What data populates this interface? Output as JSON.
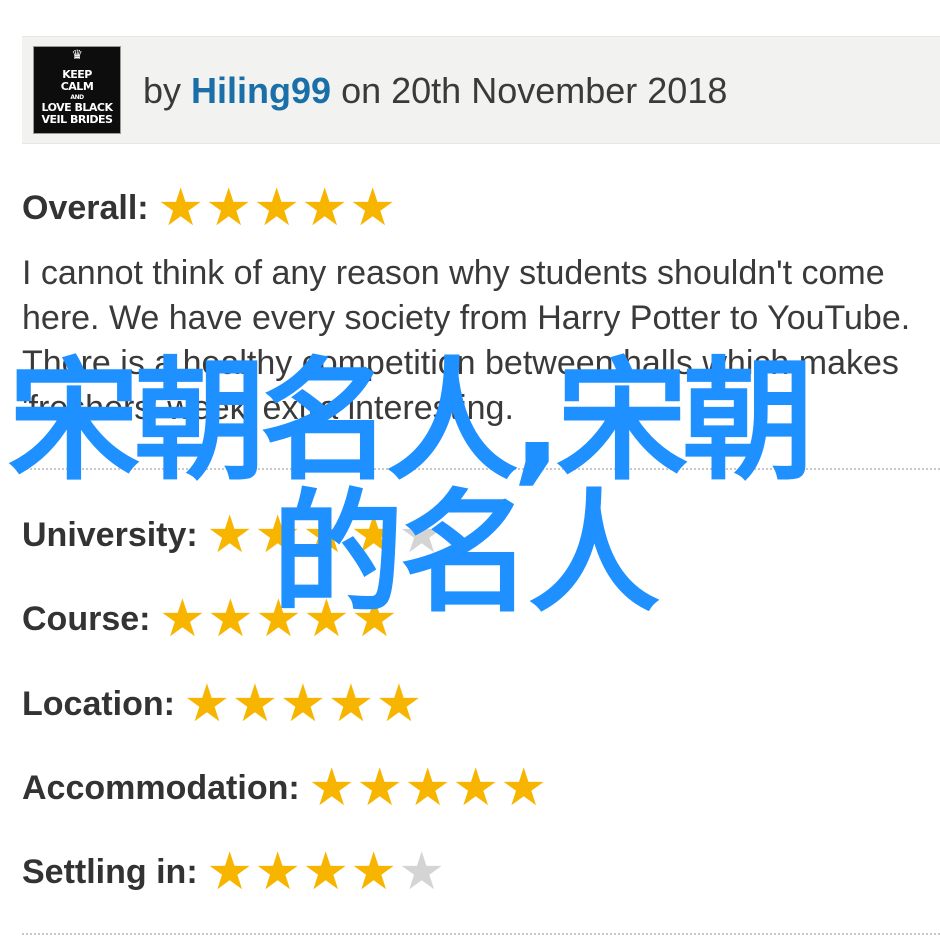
{
  "review_header": {
    "avatar_text": {
      "line1": "KEEP",
      "line2": "CALM",
      "line3": "AND",
      "line4": "LOVE BLACK",
      "line5": "VEIL BRIDES"
    },
    "by_prefix": "by",
    "username": "Hiling99",
    "date_text": "on 20th November 2018"
  },
  "overall": {
    "label": "Overall:",
    "rating": 5,
    "max": 5
  },
  "review_text": "I cannot think of any reason why students shouldn't come here. We have every society from Harry Potter to YouTube. There is a healthy competition between halls which makes 'freshers' week' extra interesting.",
  "categories": [
    {
      "label": "University:",
      "rating": 4,
      "max": 5
    },
    {
      "label": "Course:",
      "rating": 5,
      "max": 5
    },
    {
      "label": "Location:",
      "rating": 5,
      "max": 5
    },
    {
      "label": "Accommodation:",
      "rating": 5,
      "max": 5
    },
    {
      "label": "Settling in:",
      "rating": 4,
      "max": 5
    }
  ],
  "watermark": {
    "line1": "宋朝名人,宋朝",
    "line2": "的名人"
  },
  "colors": {
    "star_filled": "#f7b500",
    "star_empty": "#d4d4d4",
    "username": "#1b6fa8",
    "watermark": "#1e90ff"
  },
  "icons": {
    "star": "star-icon",
    "avatar": "avatar-image"
  }
}
